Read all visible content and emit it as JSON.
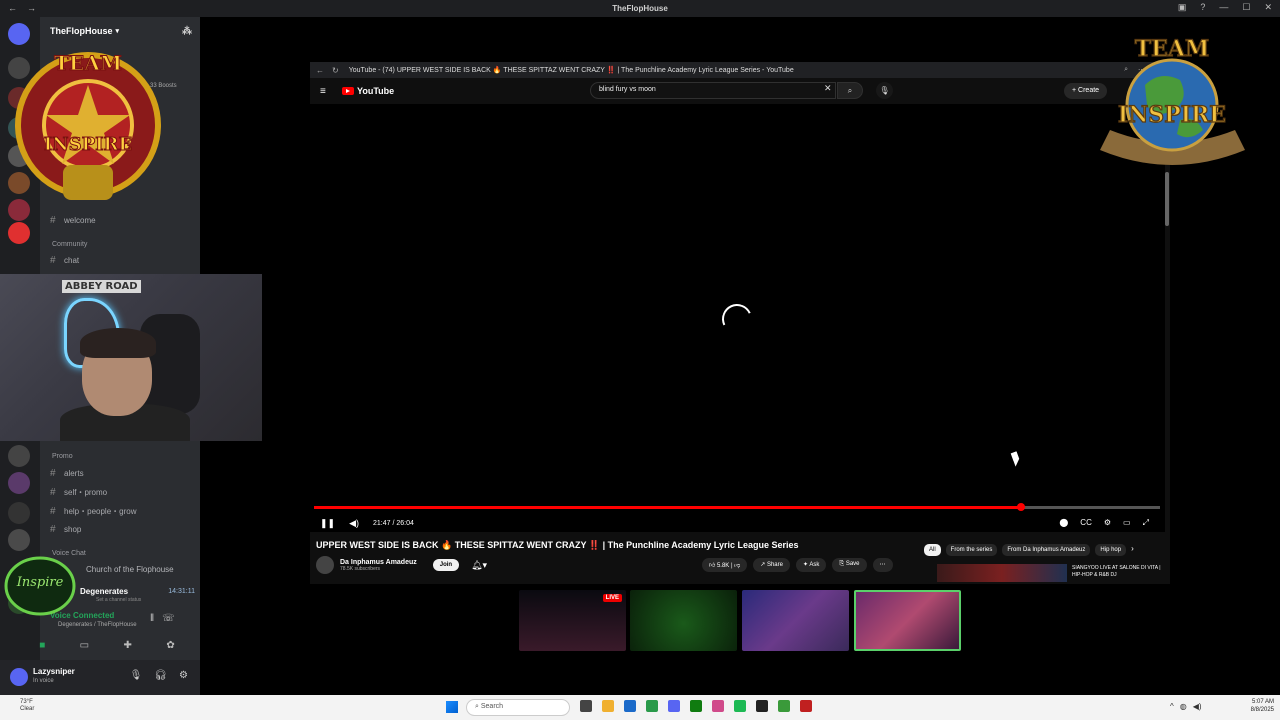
{
  "discord": {
    "window_title": "TheFlopHouse",
    "server_name": "TheFlopHouse",
    "boosts": "33 Boosts",
    "channels_top": [
      {
        "label": "welcome"
      },
      {
        "label": "chat"
      }
    ],
    "category_community": "Community",
    "category_promo": "Promo",
    "promo_channels": [
      {
        "label": "alerts"
      },
      {
        "label": "self・promo"
      },
      {
        "label": "help・people・grow"
      },
      {
        "label": "shop"
      }
    ],
    "category_voice": "Voice Chat",
    "voice_channels": [
      {
        "label": "Church of the Flophouse"
      }
    ],
    "active_voice": {
      "label": "Degenerates",
      "timer": "14:31:11",
      "status": "Set a channel status"
    },
    "voice_connected": "Voice Connected",
    "voice_location": "Degenerates / TheFlopHouse",
    "user": {
      "name": "Lazysniper",
      "status": "In voice"
    }
  },
  "webcam": {
    "sign_text": "ABBEY ROAD"
  },
  "logos": {
    "top_right": "TEAM INSPIRE",
    "left": "TEAM INSPIRE",
    "small": "Inspire"
  },
  "youtube": {
    "tab_title": "YouTube - (74) UPPER WEST SIDE IS BACK 🔥 THESE SPITTAZ WENT CRAZY ‼️ | The Punchline Academy Lyric League Series - YouTube",
    "brand": "YouTube",
    "search_query": "blind fury vs moon",
    "create_label": "Create",
    "time_display": "21:47 / 26:04",
    "progress": 0.8357,
    "video_title": "UPPER WEST SIDE IS BACK 🔥 THESE SPITTAZ WENT CRAZY ‼️ | The Punchline Academy Lyric League Series",
    "channel_name": "Da Inphamus Amadeuz",
    "subscribers": "78.5K subscribers",
    "join_label": "Join",
    "likes": "5.8K",
    "share_label": "Share",
    "ask_label": "Ask",
    "save_label": "Save",
    "chips": [
      {
        "label": "All"
      },
      {
        "label": "From the series"
      },
      {
        "label": "From Da Inphamus Amadeuz"
      },
      {
        "label": "Hip hop"
      }
    ],
    "rec_title": "SIANGYOO LIVE AT SALONE DI VITA | HIP-HOP & R&B DJ"
  },
  "guests": {
    "live_badge": "LIVE"
  },
  "taskbar": {
    "weather_temp": "73°F",
    "weather_desc": "Clear",
    "search_placeholder": "Search",
    "time": "5:07 AM",
    "date": "8/8/2025"
  }
}
